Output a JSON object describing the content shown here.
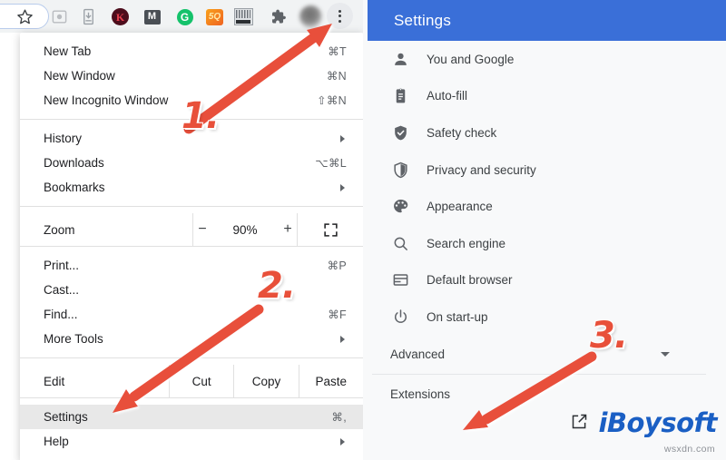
{
  "browser": {
    "toolbar": {
      "bookmark_star_icon": "star-outline-icon",
      "icons": [
        {
          "name": "cast-icon",
          "label": ""
        },
        {
          "name": "download-icon",
          "label": ""
        },
        {
          "name": "extension-k-icon",
          "label": "K"
        },
        {
          "name": "extension-m-icon",
          "label": "M"
        },
        {
          "name": "extension-grammarly-icon",
          "label": "G"
        },
        {
          "name": "extension-5q-icon",
          "label": "5Q"
        },
        {
          "name": "extension-grid-icon",
          "label": ""
        },
        {
          "name": "extensions-puzzle-icon",
          "label": ""
        }
      ],
      "profile_avatar": "profile-avatar",
      "kebab_menu": "three-dot-menu-icon"
    },
    "menu": {
      "groups": [
        {
          "items": [
            {
              "label": "New Tab",
              "accel": "⌘T",
              "submenu": false
            },
            {
              "label": "New Window",
              "accel": "⌘N",
              "submenu": false
            },
            {
              "label": "New Incognito Window",
              "accel": "⇧⌘N",
              "submenu": false
            }
          ]
        },
        {
          "items": [
            {
              "label": "History",
              "accel": "",
              "submenu": true
            },
            {
              "label": "Downloads",
              "accel": "⌥⌘L",
              "submenu": false
            },
            {
              "label": "Bookmarks",
              "accel": "",
              "submenu": true
            }
          ]
        }
      ],
      "zoom_row": {
        "label": "Zoom",
        "minus": "−",
        "value": "90%",
        "plus": "+",
        "fullscreen_icon": "fullscreen-icon"
      },
      "group3": {
        "items": [
          {
            "label": "Print...",
            "accel": "⌘P",
            "submenu": false
          },
          {
            "label": "Cast...",
            "accel": "",
            "submenu": false
          },
          {
            "label": "Find...",
            "accel": "⌘F",
            "submenu": false
          },
          {
            "label": "More Tools",
            "accel": "",
            "submenu": true
          }
        ]
      },
      "edit_row": {
        "label": "Edit",
        "cut": "Cut",
        "copy": "Copy",
        "paste": "Paste"
      },
      "group4": {
        "items": [
          {
            "label": "Settings",
            "accel": "⌘,",
            "submenu": false,
            "selected": true
          },
          {
            "label": "Help",
            "accel": "",
            "submenu": true,
            "selected": false
          }
        ]
      }
    }
  },
  "settings": {
    "header_title": "Settings",
    "header_color": "#3a6fd8",
    "items": [
      {
        "label": "You and Google",
        "icon": "person-icon"
      },
      {
        "label": "Auto-fill",
        "icon": "clipboard-icon"
      },
      {
        "label": "Safety check",
        "icon": "shield-check-icon"
      },
      {
        "label": "Privacy and security",
        "icon": "shield-icon"
      },
      {
        "label": "Appearance",
        "icon": "palette-icon"
      },
      {
        "label": "Search engine",
        "icon": "search-icon"
      },
      {
        "label": "Default browser",
        "icon": "browser-window-icon"
      },
      {
        "label": "On start-up",
        "icon": "power-icon"
      }
    ],
    "advanced": {
      "label": "Advanced",
      "caret_icon": "chevron-down-icon"
    },
    "extensions": {
      "label": "Extensions",
      "external_icon": "external-link-icon"
    }
  },
  "watermark": {
    "logo_text": "iBoysoft",
    "url_text": "wsxdn.com",
    "logo_color": "#1a5fc4"
  },
  "annotations": {
    "accent_color": "#e8503a",
    "steps": [
      {
        "label": "1.",
        "target": "three-dot-menu-icon"
      },
      {
        "label": "2.",
        "target": "menu-item-settings"
      },
      {
        "label": "3.",
        "target": "settings-extensions"
      }
    ]
  }
}
